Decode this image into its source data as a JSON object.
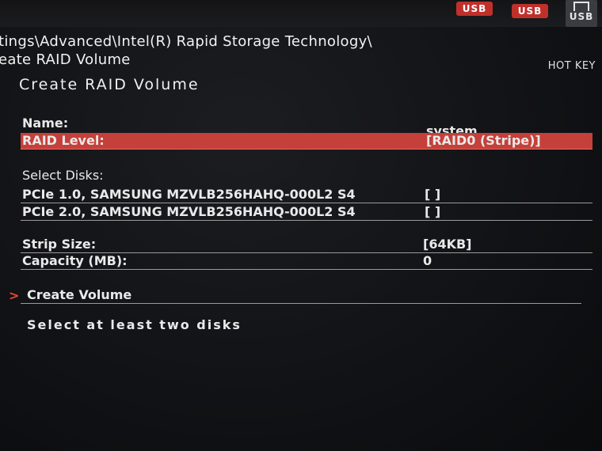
{
  "topbar": {
    "usb_label_1": "USB",
    "usb_label_2": "USB",
    "usb_label_3": "USB"
  },
  "breadcrumb": {
    "line1": "tings\\Advanced\\Intel(R) Rapid Storage Technology\\",
    "line2": "eate RAID Volume"
  },
  "hotkey": "HOT KEY",
  "screen_title": "Create RAID Volume",
  "name": {
    "label": "Name:",
    "value": "system"
  },
  "raid_level": {
    "label": "RAID Level:",
    "value": "[RAID0 (Stripe)]"
  },
  "select_disks": {
    "label": "Select Disks:",
    "disks": [
      {
        "label": "PCIe 1.0, SAMSUNG MZVLB256HAHQ-000L2 S4",
        "value": "[ ]"
      },
      {
        "label": "PCIe 2.0, SAMSUNG MZVLB256HAHQ-000L2 S4",
        "value": "[ ]"
      }
    ]
  },
  "strip_size": {
    "label": "Strip Size:",
    "value": "[64KB]"
  },
  "capacity": {
    "label": "Capacity (MB):",
    "value": "0"
  },
  "create_volume": {
    "arrow": ">",
    "label": "Create Volume"
  },
  "hint": "Select at least two disks",
  "colors": {
    "highlight": "#c5403a",
    "accent": "#e8492f",
    "usb_red": "#c0302b"
  }
}
